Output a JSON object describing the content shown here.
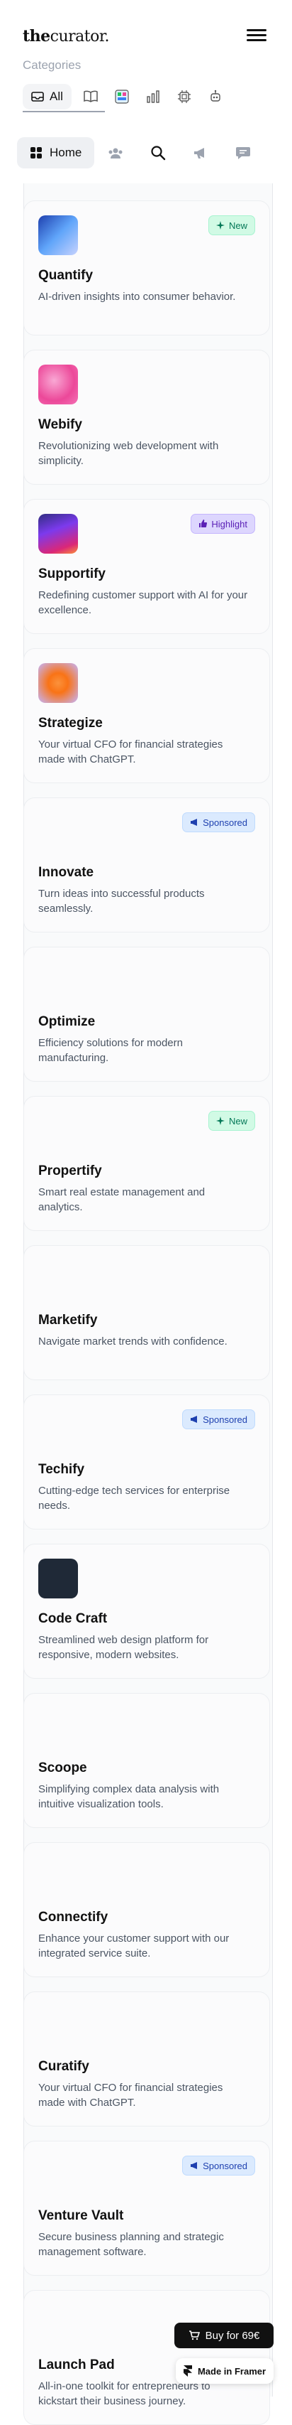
{
  "header": {
    "logo_bold": "the",
    "logo_rest": "curator.",
    "categories_label": "Categories",
    "category_all": "All"
  },
  "nav": {
    "home_label": "Home"
  },
  "cards": [
    {
      "title": "Quantify",
      "desc": "AI-driven insights into consumer behavior.",
      "badge": "New",
      "thumb": "blue-wave"
    },
    {
      "title": "Webify",
      "desc": "Revolutionizing web development with simplicity.",
      "badge": "",
      "thumb": "pink-blob"
    },
    {
      "title": "Supportify",
      "desc": "Redefining customer support with AI for your excellence.",
      "badge": "Highlight",
      "thumb": "purple-gradient"
    },
    {
      "title": "Strategize",
      "desc": "Your virtual CFO for financial strategies made with ChatGPT.",
      "badge": "",
      "thumb": "orange-glow"
    },
    {
      "title": "Innovate",
      "desc": "Turn ideas into successful products seamlessly.",
      "badge": "Sponsored",
      "thumb": ""
    },
    {
      "title": "Optimize",
      "desc": "Efficiency solutions for modern manufacturing.",
      "badge": "",
      "thumb": ""
    },
    {
      "title": "Propertify",
      "desc": "Smart real estate management and analytics.",
      "badge": "New",
      "thumb": ""
    },
    {
      "title": "Marketify",
      "desc": "Navigate market trends with confidence.",
      "badge": "",
      "thumb": ""
    },
    {
      "title": "Techify",
      "desc": "Cutting-edge tech services for enterprise needs.",
      "badge": "Sponsored",
      "thumb": ""
    },
    {
      "title": "Code Craft",
      "desc": "Streamlined web design platform for responsive, modern websites.",
      "badge": "",
      "thumb": "dark-code"
    },
    {
      "title": "Scoope",
      "desc": "Simplifying complex data analysis with intuitive visualization tools.",
      "badge": "",
      "thumb": ""
    },
    {
      "title": "Connectify",
      "desc": "Enhance your customer support with our integrated service suite.",
      "badge": "",
      "thumb": ""
    },
    {
      "title": "Curatify",
      "desc": "Your virtual CFO for financial strategies made with ChatGPT.",
      "badge": "",
      "thumb": ""
    },
    {
      "title": "Venture Vault",
      "desc": "Secure business planning and strategic management software.",
      "badge": "Sponsored",
      "thumb": ""
    },
    {
      "title": "Launch Pad",
      "desc": "All-in-one toolkit for entrepreneurs to kickstart their business journey.",
      "badge": "",
      "thumb": ""
    }
  ],
  "floating": {
    "buy_label": "Buy for 69€",
    "framer_label": "Made in Framer"
  },
  "colors": {
    "new_badge": "#d1fae5",
    "highlight_badge": "#ddd6fe",
    "sponsored_badge": "#dbeafe"
  }
}
